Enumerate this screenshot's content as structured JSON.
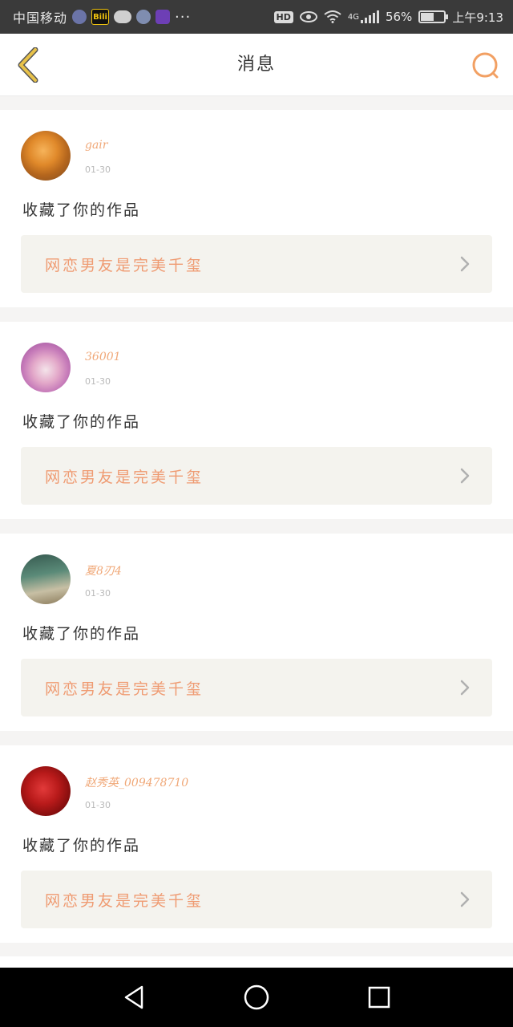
{
  "status_bar": {
    "carrier": "中国移动",
    "app_icons": [
      "app-icon",
      "bilibili-icon",
      "wechat-icon",
      "app-icon",
      "app-icon"
    ],
    "bilibili_label": "Bili",
    "more": "···",
    "hd": "HD",
    "network": "4G",
    "battery_percent": "56%",
    "battery_level": 0.56,
    "time": "上午9:13"
  },
  "header": {
    "title": "消息",
    "back_icon": "chevron-left-icon",
    "search_icon": "search-icon",
    "accent": "#f0a878",
    "back_color": "#e8b84a"
  },
  "messages": [
    {
      "username": "gair",
      "time": "01-30",
      "action": "收藏了你的作品",
      "work_title": "网恋男友是完美千玺"
    },
    {
      "username": "36001",
      "time": "01-30",
      "action": "收藏了你的作品",
      "work_title": "网恋男友是完美千玺"
    },
    {
      "username": "夏8刃4",
      "time": "01-30",
      "action": "收藏了你的作品",
      "work_title": "网恋男友是完美千玺"
    },
    {
      "username": "赵秀英_009478710",
      "time": "01-30",
      "action": "收藏了你的作品",
      "work_title": "网恋男友是完美千玺"
    }
  ],
  "nav": {
    "back": "triangle-back-icon",
    "home": "circle-home-icon",
    "recent": "square-recent-icon"
  }
}
